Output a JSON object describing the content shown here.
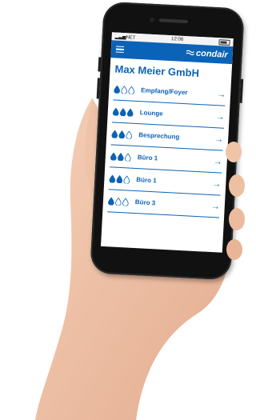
{
  "status": {
    "carrier": "NET",
    "time": "12:08"
  },
  "app": {
    "brand": "condair",
    "company": "Max Meier GmbH"
  },
  "colors": {
    "accent": "#0b63b7",
    "drop_fill": "#0b63b7",
    "drop_empty": "#ffffff"
  },
  "rooms": [
    {
      "label": "Empfang/Foyer",
      "level": 1
    },
    {
      "label": "Lounge",
      "level": 3
    },
    {
      "label": "Besprechung",
      "level": 2
    },
    {
      "label": "Büro 1",
      "level": 2
    },
    {
      "label": "Büro 1",
      "level": 2
    },
    {
      "label": "Büro 3",
      "level": 1
    }
  ],
  "icons": {
    "menu": "hamburger-icon",
    "arrow": "arrow-right-icon",
    "drop": "water-drop-icon"
  }
}
